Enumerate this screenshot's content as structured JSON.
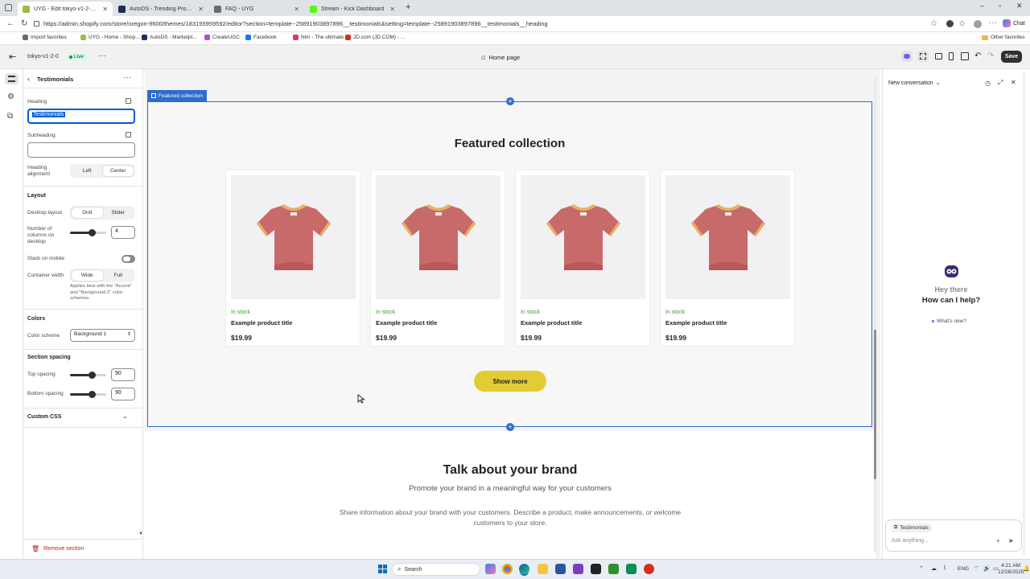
{
  "browser": {
    "tabs": [
      {
        "title": "UYG - Edit tokyo-v1-2-0 · Shopify",
        "active": true,
        "color": "#95bf47"
      },
      {
        "title": "AutoDS - Trending Products",
        "active": false,
        "color": "#1d2d5c"
      },
      {
        "title": "FAQ - UYG",
        "active": false,
        "color": "#6b6b6b"
      },
      {
        "title": "Stream - Kick Dashboard",
        "active": false,
        "color": "#53fc18"
      }
    ],
    "new_tab": "+",
    "url": "https://admin.shopify.com/store/oregon-9600/themes/183195959592/editor?section=template--25891903897896__testimonials&setting=template--25891903897896__testimonials__heading",
    "bookmarks": [
      {
        "label": "Import favorites",
        "color": "#6b6b6b"
      },
      {
        "label": "UYG - Home - Shop...",
        "color": "#95bf47"
      },
      {
        "label": "AutoDS - Marketpl...",
        "color": "#1d2d5c"
      },
      {
        "label": "CreateUGC",
        "color": "#b44ad6"
      },
      {
        "label": "Facebook",
        "color": "#1877f2"
      },
      {
        "label": "Nim - The ultimate...",
        "color": "#d63a7a"
      },
      {
        "label": "JD.com (JD.COM) - ...",
        "color": "#d62d20"
      }
    ],
    "other_favorites": "Other favorites",
    "copilot": "Chat"
  },
  "editor": {
    "theme_name": "tokyo-v1-2-0",
    "live_badge": "Live",
    "page_selector": "Home page",
    "save_label": "Save"
  },
  "settings": {
    "back_title": "Testimonials",
    "heading_label": "Heading",
    "heading_value": "Testimonials",
    "subheading_label": "Subheading",
    "subheading_value": "",
    "alignment_label": "Heading alignment",
    "alignment_options": [
      "Left",
      "Center"
    ],
    "alignment_selected": "Center",
    "layout_title": "Layout",
    "desktop_layout_label": "Desktop layout",
    "desktop_layout_options": [
      "Grid",
      "Slider"
    ],
    "desktop_layout_selected": "Grid",
    "columns_label": "Number of columns on desktop",
    "columns_value": "4",
    "columns_level": 0.6,
    "stack_label": "Stack on mobile",
    "container_label": "Container width",
    "container_options": [
      "Wide",
      "Full"
    ],
    "container_selected": "Wide",
    "container_help": "Applies best with the \"Accent\" and \"Background 2\" color schemes.",
    "colors_title": "Colors",
    "color_scheme_label": "Color scheme",
    "color_scheme_value": "Background 1",
    "spacing_title": "Section spacing",
    "top_spacing_label": "Top spacing",
    "top_spacing_value": "90",
    "bottom_spacing_label": "Bottom spacing",
    "bottom_spacing_value": "90",
    "custom_css_label": "Custom CSS",
    "remove_label": "Remove section"
  },
  "preview": {
    "section_tag": "Featured collection",
    "heading": "Featured collection",
    "products": [
      {
        "stock": "In stock",
        "title": "Example product title",
        "price": "$19.99"
      },
      {
        "stock": "In stock",
        "title": "Example product title",
        "price": "$19.99"
      },
      {
        "stock": "In stock",
        "title": "Example product title",
        "price": "$19.99"
      },
      {
        "stock": "In stock",
        "title": "Example product title",
        "price": "$19.99"
      }
    ],
    "show_more": "Show more",
    "brand_heading": "Talk about your brand",
    "brand_subheading": "Promote your brand in a meaningful way for your customers",
    "brand_text": "Share information about your brand with your customers. Describe a product, make announcements, or welcome customers to your store."
  },
  "assistant": {
    "title": "New conversation",
    "greeting": "Hey there",
    "question": "How can I help?",
    "whats_new": "What's new?",
    "context_chip": "Testimonials",
    "input_placeholder": "Ask anything..."
  },
  "taskbar": {
    "search_placeholder": "Search",
    "lang": "ENG",
    "time": "4:21 AM",
    "date": "12/28/2025"
  }
}
